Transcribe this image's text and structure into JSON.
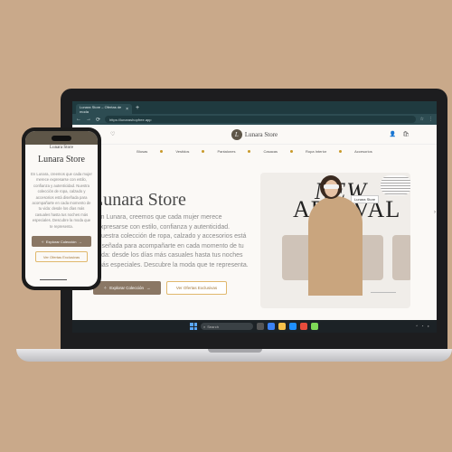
{
  "browser": {
    "tab_title": "Lunara Store – Ofertas de moda",
    "tab_close": "×",
    "tab_new": "+",
    "url": "https://lunarashopfree.app",
    "back": "←",
    "forward": "→",
    "reload": "⟳",
    "star": "☆",
    "menu": "⋮"
  },
  "site": {
    "brand": "Lunara Store",
    "logo_letter": "L",
    "nav": [
      "Blusas",
      "Vestidos",
      "Pantalones",
      "Casacas",
      "Ropa Interior",
      "Accesorios"
    ],
    "hero_title": "Lunara Store",
    "hero_text": "En Lunara, creemos que cada mujer merece expresarse con estilo, confianza y autenticidad. Nuestra colección de ropa, calzado y accesorios está diseñada para acompañarte en cada momento de tu vida: desde los días más casuales hasta tus noches más especiales. Descubre la moda que te representa.",
    "btn_explore": "Explorar Colección",
    "btn_offers": "Ver Ofertas Exclusivas",
    "promo_new": "NEW",
    "promo_arrival": "ARRIVAL",
    "promo_tag": "Lunara Store"
  },
  "taskbar": {
    "search": "Search"
  },
  "phone": {
    "brand": "Lunara Store",
    "title": "Lunara Store",
    "text": "En Lunara, creemos que cada mujer merece expresarse con estilo, confianza y autenticidad. Nuestra colección de ropa, calzado y accesorios está diseñada para acompañarte en cada momento de tu vida: desde los días más casuales hasta tus noches más especiales. Descubre la moda que te representa.",
    "btn_explore": "Explorar Colección",
    "btn_offers": "Ver Ofertas Exclusivas"
  },
  "colors": {
    "background": "#c9a98a",
    "accent": "#8a7764",
    "gold": "#e0b86d",
    "browser": "#1f3a3f"
  }
}
